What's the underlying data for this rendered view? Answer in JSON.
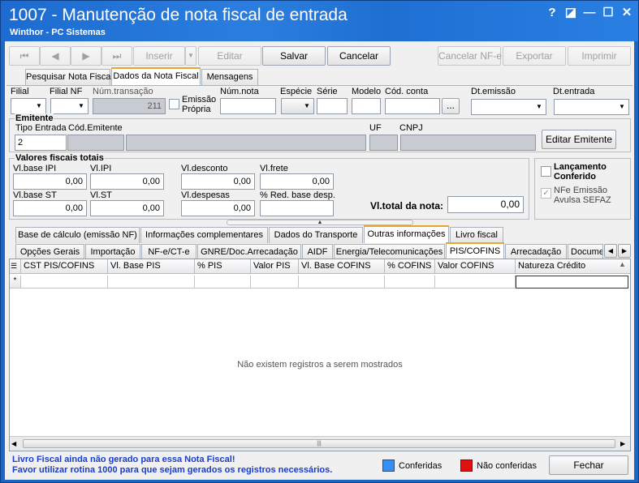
{
  "window": {
    "title": "1007 - Manutenção de nota fiscal de entrada",
    "subtitle": "Winthor - PC Sistemas",
    "controls": {
      "help": "?",
      "restore": "◪",
      "minimize": "—",
      "maximize": "☐",
      "close": "✕"
    }
  },
  "toolbar": {
    "first": "⏮",
    "prev": "◀",
    "next": "▶",
    "last": "⏭",
    "inserir": "Inserir",
    "editar": "Editar",
    "salvar": "Salvar",
    "cancelar": "Cancelar",
    "cancelar_nfe": "Cancelar NF-e",
    "exportar": "Exportar",
    "imprimir": "Imprimir"
  },
  "main_tabs": [
    "Pesquisar Nota Fiscal",
    "Dados da Nota Fiscal",
    "Mensagens"
  ],
  "header_fields": {
    "filial": "Filial",
    "filial_nf": "Filial NF",
    "num_transacao": "Núm.transação",
    "num_transacao_value": "211",
    "emissao_propria": "Emissão Própria",
    "num_nota": "Núm.nota",
    "especie": "Espécie",
    "serie": "Série",
    "modelo": "Modelo",
    "cod_conta": "Cód. conta",
    "cod_conta_btn": "...",
    "dt_emissao": "Dt.emissão",
    "dt_entrada": "Dt.entrada"
  },
  "emitente": {
    "title": "Emitente",
    "tipo_entrada": "Tipo Entrada",
    "tipo_entrada_value": "2",
    "cod_emitente": "Cód.Emitente",
    "uf": "UF",
    "cnpj": "CNPJ",
    "editar_emitente": "Editar Emitente"
  },
  "valores": {
    "title": "Valores fiscais totais",
    "vl_base_ipi": "Vl.base IPI",
    "vl_base_ipi_value": "0,00",
    "vl_ipi": "Vl.IPI",
    "vl_ipi_value": "0,00",
    "vl_desconto": "Vl.desconto",
    "vl_desconto_value": "0,00",
    "vl_frete": "Vl.frete",
    "vl_frete_value": "0,00",
    "vl_base_st": "Vl.base ST",
    "vl_base_st_value": "0,00",
    "vl_st": "Vl.ST",
    "vl_st_value": "0,00",
    "vl_despesas": "Vl.despesas",
    "vl_despesas_value": "0,00",
    "red_base": "% Red. base desp.",
    "red_base_value": "",
    "vl_total": "Vl.total da nota:",
    "vl_total_value": "0,00"
  },
  "lancamento": {
    "conferido": "Lançamento Conferido",
    "nfe_avulsa": "NFe Emissão Avulsa SEFAZ"
  },
  "sub_tabs_row1": [
    "Base de cálculo (emissão NF)",
    "Informações complementares",
    "Dados do Transporte",
    "Outras informações",
    "Livro fiscal"
  ],
  "sub_tabs_row2": [
    "Opções Gerais",
    "Importação",
    "NF-e/CT-e",
    "GNRE/Doc.Arrecadação",
    "AIDF",
    "Energia/Telecomunicações",
    "PIS/COFINS",
    "Arrecadação",
    "Docume"
  ],
  "grid": {
    "columns": [
      "CST PIS/COFINS",
      "Vl. Base PIS",
      "% PIS",
      "Valor PIS",
      "Vl. Base COFINS",
      "% COFINS",
      "Valor COFINS",
      "Natureza Crédito"
    ],
    "new_row_marker": "*",
    "empty_message": "Não existem registros a serem mostrados"
  },
  "footer": {
    "line1": "Livro Fiscal ainda não gerado para essa Nota Fiscal!",
    "line2": "Favor utilizar rotina 1000 para que sejam gerados os registros necessários.",
    "legend_conferidas": "Conferidas",
    "legend_nao_conferidas": "Não conferidas",
    "fechar": "Fechar"
  },
  "colors": {
    "conferidas": "#3a8ef0",
    "nao_conferidas": "#e01010",
    "title_bar": "#1d6bd0"
  }
}
